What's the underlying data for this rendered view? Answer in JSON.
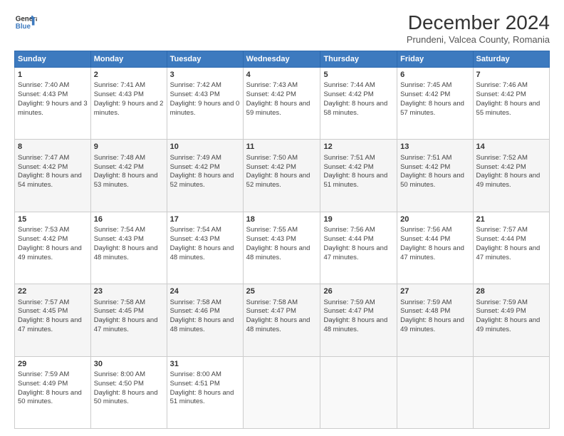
{
  "logo": {
    "line1": "General",
    "line2": "Blue"
  },
  "title": "December 2024",
  "subtitle": "Prundeni, Valcea County, Romania",
  "header_days": [
    "Sunday",
    "Monday",
    "Tuesday",
    "Wednesday",
    "Thursday",
    "Friday",
    "Saturday"
  ],
  "weeks": [
    [
      {
        "day": "1",
        "sunrise": "Sunrise: 7:40 AM",
        "sunset": "Sunset: 4:43 PM",
        "daylight": "Daylight: 9 hours and 3 minutes."
      },
      {
        "day": "2",
        "sunrise": "Sunrise: 7:41 AM",
        "sunset": "Sunset: 4:43 PM",
        "daylight": "Daylight: 9 hours and 2 minutes."
      },
      {
        "day": "3",
        "sunrise": "Sunrise: 7:42 AM",
        "sunset": "Sunset: 4:43 PM",
        "daylight": "Daylight: 9 hours and 0 minutes."
      },
      {
        "day": "4",
        "sunrise": "Sunrise: 7:43 AM",
        "sunset": "Sunset: 4:42 PM",
        "daylight": "Daylight: 8 hours and 59 minutes."
      },
      {
        "day": "5",
        "sunrise": "Sunrise: 7:44 AM",
        "sunset": "Sunset: 4:42 PM",
        "daylight": "Daylight: 8 hours and 58 minutes."
      },
      {
        "day": "6",
        "sunrise": "Sunrise: 7:45 AM",
        "sunset": "Sunset: 4:42 PM",
        "daylight": "Daylight: 8 hours and 57 minutes."
      },
      {
        "day": "7",
        "sunrise": "Sunrise: 7:46 AM",
        "sunset": "Sunset: 4:42 PM",
        "daylight": "Daylight: 8 hours and 55 minutes."
      }
    ],
    [
      {
        "day": "8",
        "sunrise": "Sunrise: 7:47 AM",
        "sunset": "Sunset: 4:42 PM",
        "daylight": "Daylight: 8 hours and 54 minutes."
      },
      {
        "day": "9",
        "sunrise": "Sunrise: 7:48 AM",
        "sunset": "Sunset: 4:42 PM",
        "daylight": "Daylight: 8 hours and 53 minutes."
      },
      {
        "day": "10",
        "sunrise": "Sunrise: 7:49 AM",
        "sunset": "Sunset: 4:42 PM",
        "daylight": "Daylight: 8 hours and 52 minutes."
      },
      {
        "day": "11",
        "sunrise": "Sunrise: 7:50 AM",
        "sunset": "Sunset: 4:42 PM",
        "daylight": "Daylight: 8 hours and 52 minutes."
      },
      {
        "day": "12",
        "sunrise": "Sunrise: 7:51 AM",
        "sunset": "Sunset: 4:42 PM",
        "daylight": "Daylight: 8 hours and 51 minutes."
      },
      {
        "day": "13",
        "sunrise": "Sunrise: 7:51 AM",
        "sunset": "Sunset: 4:42 PM",
        "daylight": "Daylight: 8 hours and 50 minutes."
      },
      {
        "day": "14",
        "sunrise": "Sunrise: 7:52 AM",
        "sunset": "Sunset: 4:42 PM",
        "daylight": "Daylight: 8 hours and 49 minutes."
      }
    ],
    [
      {
        "day": "15",
        "sunrise": "Sunrise: 7:53 AM",
        "sunset": "Sunset: 4:42 PM",
        "daylight": "Daylight: 8 hours and 49 minutes."
      },
      {
        "day": "16",
        "sunrise": "Sunrise: 7:54 AM",
        "sunset": "Sunset: 4:43 PM",
        "daylight": "Daylight: 8 hours and 48 minutes."
      },
      {
        "day": "17",
        "sunrise": "Sunrise: 7:54 AM",
        "sunset": "Sunset: 4:43 PM",
        "daylight": "Daylight: 8 hours and 48 minutes."
      },
      {
        "day": "18",
        "sunrise": "Sunrise: 7:55 AM",
        "sunset": "Sunset: 4:43 PM",
        "daylight": "Daylight: 8 hours and 48 minutes."
      },
      {
        "day": "19",
        "sunrise": "Sunrise: 7:56 AM",
        "sunset": "Sunset: 4:44 PM",
        "daylight": "Daylight: 8 hours and 47 minutes."
      },
      {
        "day": "20",
        "sunrise": "Sunrise: 7:56 AM",
        "sunset": "Sunset: 4:44 PM",
        "daylight": "Daylight: 8 hours and 47 minutes."
      },
      {
        "day": "21",
        "sunrise": "Sunrise: 7:57 AM",
        "sunset": "Sunset: 4:44 PM",
        "daylight": "Daylight: 8 hours and 47 minutes."
      }
    ],
    [
      {
        "day": "22",
        "sunrise": "Sunrise: 7:57 AM",
        "sunset": "Sunset: 4:45 PM",
        "daylight": "Daylight: 8 hours and 47 minutes."
      },
      {
        "day": "23",
        "sunrise": "Sunrise: 7:58 AM",
        "sunset": "Sunset: 4:45 PM",
        "daylight": "Daylight: 8 hours and 47 minutes."
      },
      {
        "day": "24",
        "sunrise": "Sunrise: 7:58 AM",
        "sunset": "Sunset: 4:46 PM",
        "daylight": "Daylight: 8 hours and 48 minutes."
      },
      {
        "day": "25",
        "sunrise": "Sunrise: 7:58 AM",
        "sunset": "Sunset: 4:47 PM",
        "daylight": "Daylight: 8 hours and 48 minutes."
      },
      {
        "day": "26",
        "sunrise": "Sunrise: 7:59 AM",
        "sunset": "Sunset: 4:47 PM",
        "daylight": "Daylight: 8 hours and 48 minutes."
      },
      {
        "day": "27",
        "sunrise": "Sunrise: 7:59 AM",
        "sunset": "Sunset: 4:48 PM",
        "daylight": "Daylight: 8 hours and 49 minutes."
      },
      {
        "day": "28",
        "sunrise": "Sunrise: 7:59 AM",
        "sunset": "Sunset: 4:49 PM",
        "daylight": "Daylight: 8 hours and 49 minutes."
      }
    ],
    [
      {
        "day": "29",
        "sunrise": "Sunrise: 7:59 AM",
        "sunset": "Sunset: 4:49 PM",
        "daylight": "Daylight: 8 hours and 50 minutes."
      },
      {
        "day": "30",
        "sunrise": "Sunrise: 8:00 AM",
        "sunset": "Sunset: 4:50 PM",
        "daylight": "Daylight: 8 hours and 50 minutes."
      },
      {
        "day": "31",
        "sunrise": "Sunrise: 8:00 AM",
        "sunset": "Sunset: 4:51 PM",
        "daylight": "Daylight: 8 hours and 51 minutes."
      },
      null,
      null,
      null,
      null
    ]
  ]
}
